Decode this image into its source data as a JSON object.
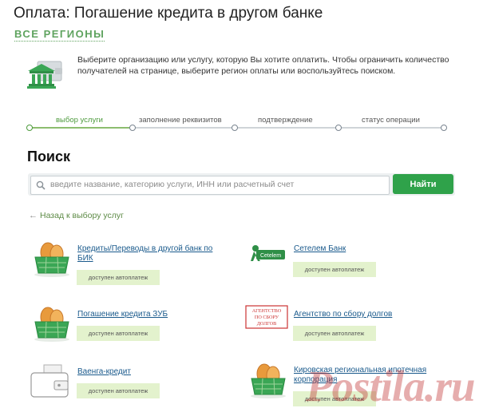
{
  "header": {
    "title": "Оплата: Погашение кредита в другом банке",
    "regions": "ВСЕ РЕГИОНЫ"
  },
  "intro": {
    "text": "Выберите организацию или услугу, которую Вы хотите оплатить. Чтобы ограничить количество получателей на странице, выберите регион оплаты или воспользуйтесь поиском."
  },
  "steps": [
    {
      "label": "выбор услуги",
      "active": true
    },
    {
      "label": "заполнение реквизитов",
      "active": false
    },
    {
      "label": "подтверждение",
      "active": false
    },
    {
      "label": "статус операции",
      "active": false
    }
  ],
  "search": {
    "title": "Поиск",
    "placeholder": "введите название, категорию услуги, ИНН или расчетный счет",
    "button": "Найти"
  },
  "back_link": "Назад к выбору услуг",
  "services": [
    {
      "name": "Кредиты/Переводы в другой банк по БИК",
      "badge": "доступен автоплатеж",
      "icon": "money-basket-icon"
    },
    {
      "name": "Сетелем Банк",
      "badge": "доступен автоплатеж",
      "icon": "cetelem-logo"
    },
    {
      "name": "Погашение кредита ЗУБ",
      "badge": "доступен автоплатеж",
      "icon": "money-basket-icon"
    },
    {
      "name": "Агентство по сбору долгов",
      "badge": "доступен автоплатеж",
      "icon": "debt-agency-logo"
    },
    {
      "name": "Ваенга-кредит",
      "badge": "доступен автоплатеж",
      "icon": "wallet-icon"
    },
    {
      "name": "Кировская региональная ипотечная корпорация",
      "badge": "доступен автоплатеж",
      "icon": "money-basket-icon"
    }
  ],
  "logos": {
    "cetelem": "Cetelem",
    "debt_agency": [
      "АГЕНТСТВО",
      "ПО СБОРУ",
      "ДОЛГОВ"
    ]
  },
  "watermark": "Postila.ru",
  "colors": {
    "brand_green": "#2fa24a",
    "step_active": "#4c9a3c",
    "link": "#1a5a8c",
    "badge_bg": "#e3f2cd"
  }
}
